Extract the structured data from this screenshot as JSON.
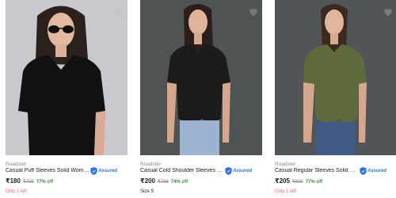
{
  "products": [
    {
      "brand": "Roadster",
      "title": "Casual Puff Sleeves Solid Women Black Top",
      "price": "₹180",
      "mrp": "₹799",
      "discount": "77% off",
      "assured_label": "Assured",
      "note": "Only 1 left",
      "wishlist_icon": "heart-icon",
      "colors": {
        "background": "#c9c9cd",
        "garment": "#111111"
      }
    },
    {
      "brand": "Roadster",
      "title": "Casual Cold Shoulder Sleeves Solid Women Black Top",
      "price": "₹200",
      "mrp": "₹799",
      "discount": "74% off",
      "assured_label": "Assured",
      "note": "Size S",
      "wishlist_icon": "heart-icon",
      "colors": {
        "background": "#505354",
        "garment": "#1b1b1b"
      }
    },
    {
      "brand": "Roadster",
      "title": "Casual Regular Sleeves Solid Women Green Top",
      "price": "₹205",
      "mrp": "₹899",
      "discount": "77% off",
      "assured_label": "Assured",
      "note": "Only 1 left",
      "wishlist_icon": "heart-icon",
      "colors": {
        "background": "#525557",
        "garment": "#5f6a3c"
      }
    }
  ],
  "colors": {
    "assured_blue": "#2874f0",
    "discount_green": "#388e3c",
    "stock_red": "#ff6161"
  }
}
